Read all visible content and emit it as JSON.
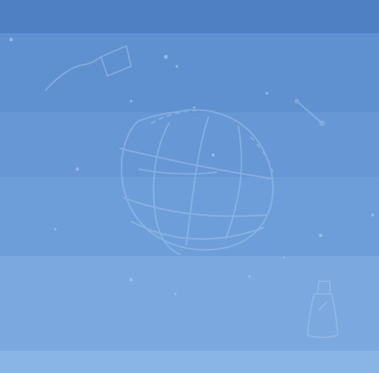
{
  "background": {
    "bands": [
      {
        "color": "#4f80c4"
      },
      {
        "color": "#5f90d0"
      },
      {
        "color": "#6797d5"
      },
      {
        "color": "#6d9ed9"
      },
      {
        "color": "#7aa8df"
      },
      {
        "color": "#89b4e6"
      }
    ],
    "sketch_color": "#a8c8f0",
    "icons": [
      "globe-sketch-icon",
      "constellation-sketch-icon",
      "satellite-sketch-icon",
      "bottle-sketch-icon"
    ]
  }
}
